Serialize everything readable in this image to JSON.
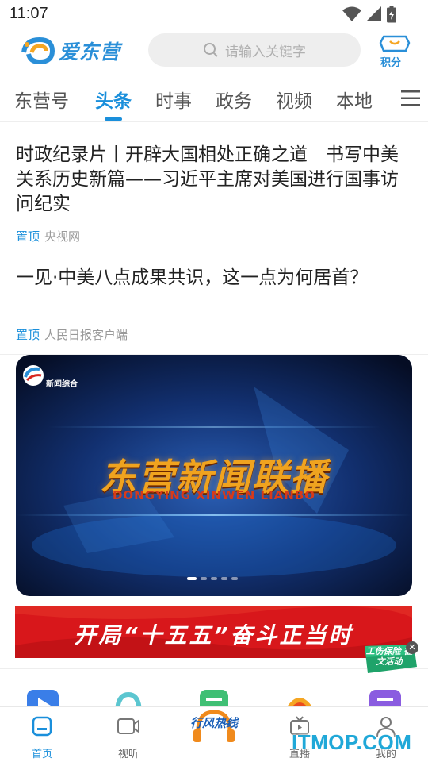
{
  "status_bar": {
    "time": "11:07"
  },
  "header": {
    "logo_text": "爱东营",
    "search_placeholder": "请输入关键字",
    "points_label": "积分"
  },
  "tabs": [
    {
      "label": "东营号",
      "active": false
    },
    {
      "label": "头条",
      "active": true
    },
    {
      "label": "时事",
      "active": false
    },
    {
      "label": "政务",
      "active": false
    },
    {
      "label": "视频",
      "active": false
    },
    {
      "label": "本地",
      "active": false
    }
  ],
  "news": [
    {
      "title": "时政纪录片丨开辟大国相处正确之道　书写中美关系历史新篇——习近平主席对美国进行国事访问纪实",
      "tag": "置顶",
      "source": "央视网"
    },
    {
      "title": "一见·中美八点成果共识，这一点为何居首？",
      "tag": "置顶",
      "source": "人民日报客户端"
    }
  ],
  "banner": {
    "channel": "新闻综合",
    "title": "东营新闻联播",
    "subtitle": "DONGYING XINWEN LIANBO",
    "slide_count": 5,
    "active_slide": 0
  },
  "ad": {
    "text": "开局“十五五”奋斗正当时"
  },
  "float_promo": {
    "text": "工伤保险 征文活动"
  },
  "bottom_nav": [
    {
      "label": "首页",
      "active": true
    },
    {
      "label": "视听",
      "active": false
    },
    {
      "label": "",
      "center_text": "行风热线",
      "active": false
    },
    {
      "label": "直播",
      "active": false
    },
    {
      "label": "我的",
      "active": false
    }
  ],
  "watermark": "ITMOP.COM",
  "colors": {
    "accent": "#1a8fdb",
    "ad_red": "#d8171b",
    "banner_gold": "#f0a31f"
  }
}
